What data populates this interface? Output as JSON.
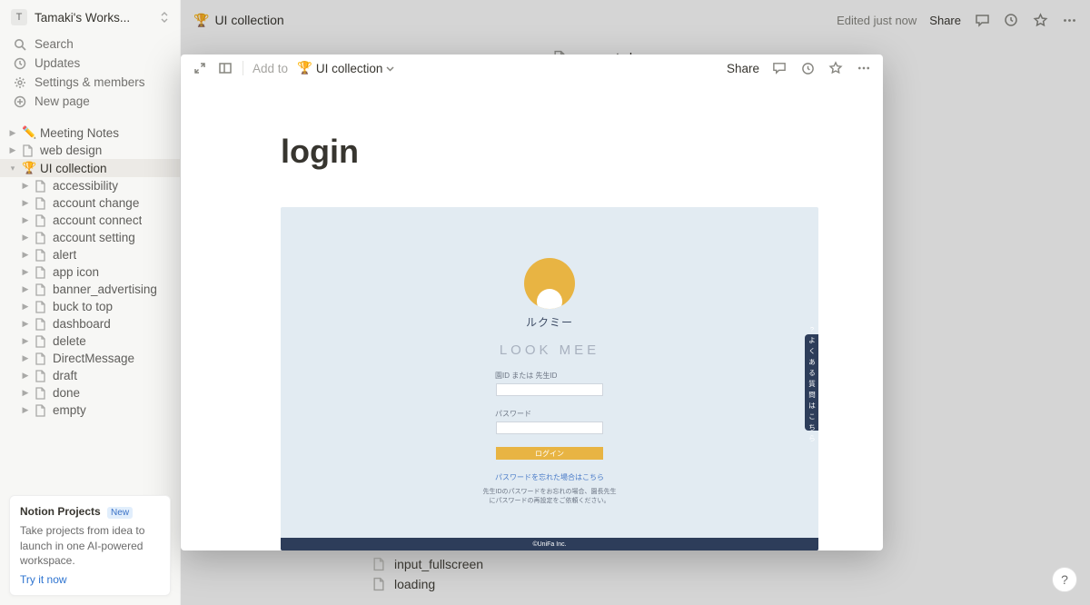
{
  "workspace": {
    "initial": "T",
    "name": "Tamaki's Works..."
  },
  "nav": {
    "search": "Search",
    "updates": "Updates",
    "settings": "Settings & members",
    "new_page": "New page"
  },
  "tree": {
    "top": [
      {
        "icon": "✏️",
        "label": "Meeting Notes"
      },
      {
        "icon": "doc",
        "label": "web design"
      },
      {
        "icon": "🏆",
        "label": "UI collection",
        "active": true
      }
    ],
    "ui_children": [
      "accessibility",
      "account change",
      "account connect",
      "account setting",
      "alert",
      "app icon",
      "banner_advertising",
      "buck to top",
      "dashboard",
      "delete",
      "DirectMessage",
      "draft",
      "done",
      "empty"
    ]
  },
  "promo": {
    "title": "Notion Projects",
    "badge": "New",
    "desc": "Take projects from idea to launch in one AI-powered workspace.",
    "cta": "Try it now"
  },
  "topbar": {
    "icon": "🏆",
    "title": "UI collection",
    "edited": "Edited just now",
    "share": "Share"
  },
  "bg_list": [
    "account change",
    "input_fullscreen",
    "loading"
  ],
  "modal": {
    "addto": "Add to",
    "dest_icon": "🏆",
    "dest": "UI collection",
    "share": "Share",
    "h1": "login"
  },
  "login": {
    "kana": "ルクミー",
    "eng": "LOOK MEE",
    "id_label": "園ID または 先生ID",
    "pw_label": "パスワード",
    "btn": "ログイン",
    "forgot": "パスワードを忘れた場合はこちら",
    "note": "先生IDのパスワードをお忘れの場合、園長先生にパスワードの再設定をご依頼ください。",
    "footer": "©UniFa Inc.",
    "faq": "? よくある質問はこちら"
  }
}
